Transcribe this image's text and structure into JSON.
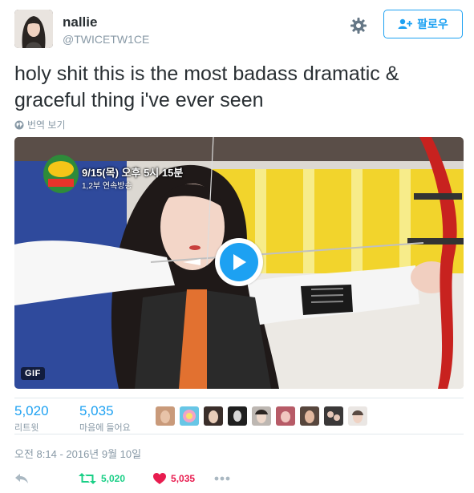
{
  "user": {
    "display_name": "nallie",
    "handle": "@TWICETW1CE",
    "follow_label": "팔로우"
  },
  "tweet": {
    "text": "holy shit this is the most badass dramatic & graceful thing i've ever seen",
    "translate_label": "번역 보기"
  },
  "media": {
    "badge": "GIF",
    "overlay_date": "9/15(목) 오후 5시 15분",
    "overlay_sub": "1,2부 연속방송"
  },
  "stats": {
    "retweets_count": "5,020",
    "retweets_label": "리트윗",
    "likes_count": "5,035",
    "likes_label": "마음에 들어요"
  },
  "timestamp": "오전 8:14 - 2016년 9월 10일",
  "actions": {
    "retweet_count": "5,020",
    "like_count": "5,035"
  },
  "colors": {
    "accent": "#1da1f2",
    "retweet": "#19cf86",
    "like": "#e81c4f",
    "muted": "#8899a6"
  },
  "icons": [
    "gear-icon",
    "follow-person-icon",
    "globe-icon",
    "play-icon",
    "reply-icon",
    "retweet-icon",
    "heart-icon",
    "more-icon"
  ]
}
